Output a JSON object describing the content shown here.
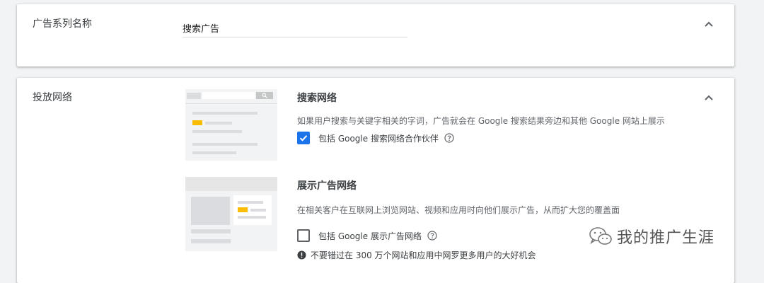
{
  "campaign_name": {
    "label": "广告系列名称",
    "value": "搜索广告"
  },
  "networks": {
    "label": "投放网络",
    "search": {
      "title": "搜索网络",
      "description": "如果用户搜索与关键字相关的字词，广告就会在 Google 搜索结果旁边和其他 Google 网站上展示",
      "checkbox_label": "包括 Google 搜索网络合作伙伴",
      "checked": true
    },
    "display": {
      "title": "展示广告网络",
      "description": "在相关客户在互联网上浏览网站、视频和应用时向他们展示广告，从而扩大您的覆盖面",
      "checkbox_label": "包括 Google 展示广告网络",
      "checked": false,
      "info": "不要错过在 300 万个网站和应用中网罗更多用户的大好机会"
    }
  },
  "watermark": {
    "text": "我的推广生涯"
  },
  "colors": {
    "accent": "#1a73e8",
    "highlight": "#fbbc04",
    "background": "#f1f3f4"
  },
  "icons": {
    "collapse": "chevron-up-icon",
    "help": "help-circle-icon",
    "info": "info-filled-icon",
    "search": "search-icon",
    "watermark": "wechat-icon"
  }
}
